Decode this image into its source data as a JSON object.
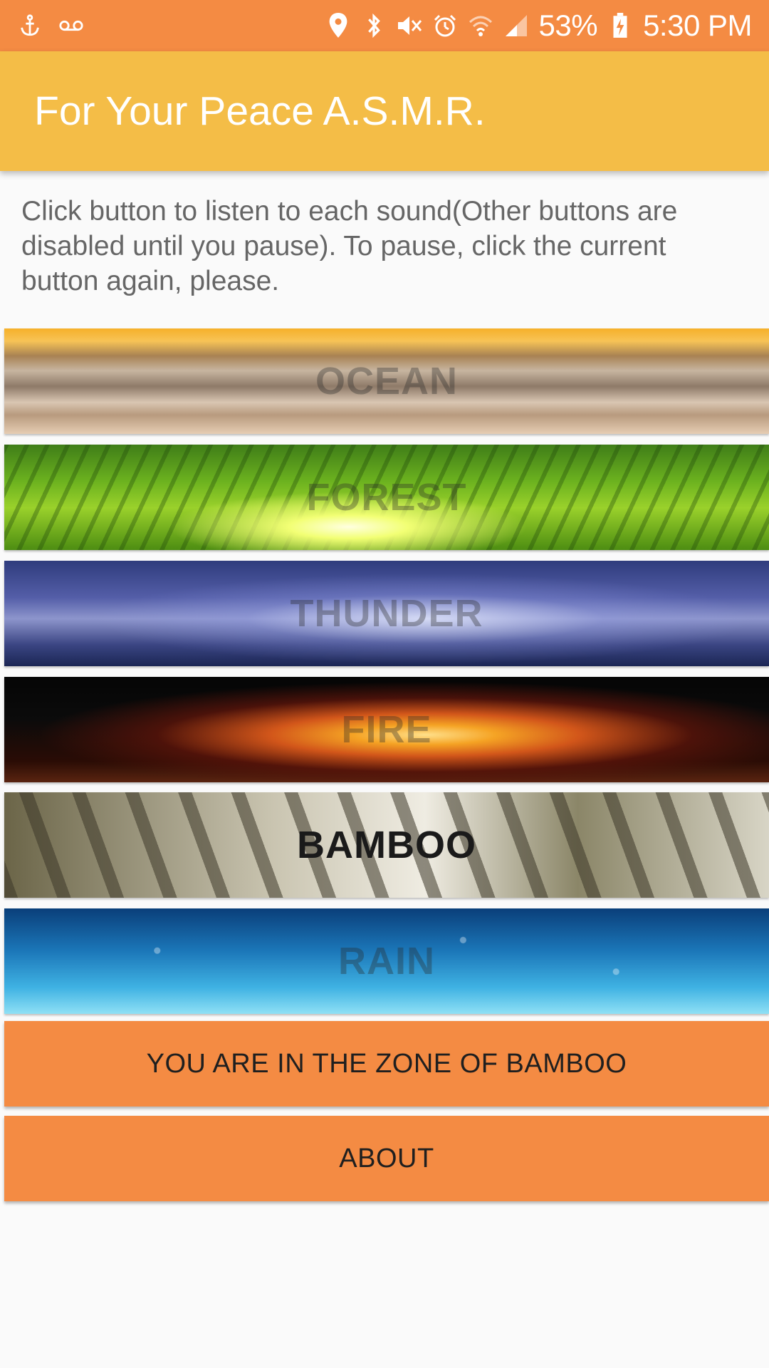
{
  "status_bar": {
    "battery": "53%",
    "time": "5:30 PM",
    "left_icons": [
      "anchor-icon",
      "voicemail-icon"
    ],
    "right_icons": [
      "location-icon",
      "bluetooth-icon",
      "mute-icon",
      "alarm-icon",
      "wifi-icon",
      "signal-icon",
      "battery-charging-icon"
    ]
  },
  "app_bar": {
    "title": "For Your Peace A.S.M.R."
  },
  "instructions": "Click button to listen to each sound(Other buttons are disabled until you pause). To pause, click the current button again, please.",
  "sounds": [
    {
      "label": "OCEAN"
    },
    {
      "label": "FOREST"
    },
    {
      "label": "THUNDER"
    },
    {
      "label": "FIRE"
    },
    {
      "label": "BAMBOO"
    },
    {
      "label": "RAIN"
    }
  ],
  "zone_button": "YOU ARE IN THE ZONE OF BAMBOO",
  "about_button": "ABOUT",
  "colors": {
    "status_bar": "#f48b43",
    "app_bar": "#f4bd47",
    "button": "#f48b43",
    "background": "#fafafa"
  }
}
